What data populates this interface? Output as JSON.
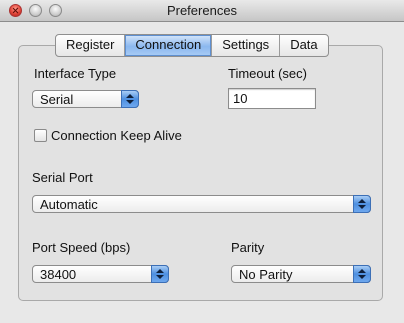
{
  "window": {
    "title": "Preferences"
  },
  "tabs": [
    "Register",
    "Connection",
    "Settings",
    "Data"
  ],
  "active_tab": "Connection",
  "interface_type": {
    "label": "Interface Type",
    "value": "Serial"
  },
  "timeout": {
    "label": "Timeout (sec)",
    "value": "10"
  },
  "keep_alive": {
    "label": "Connection Keep Alive",
    "checked": false
  },
  "serial_port": {
    "label": "Serial Port",
    "value": "Automatic"
  },
  "port_speed": {
    "label": "Port Speed (bps)",
    "value": "38400"
  },
  "parity": {
    "label": "Parity",
    "value": "No Parity"
  },
  "accent_color": "#5d9bea"
}
